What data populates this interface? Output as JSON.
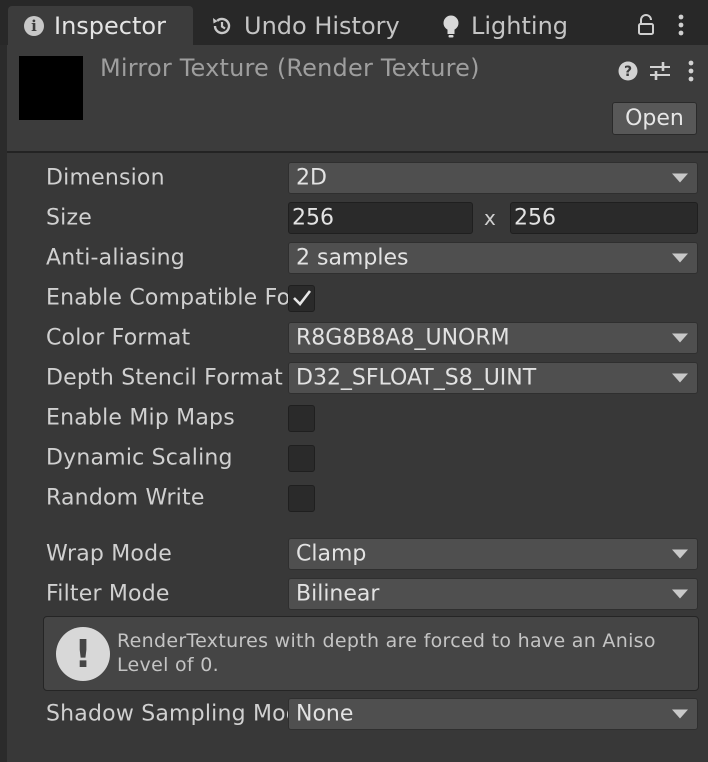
{
  "tabs": [
    {
      "label": "Inspector",
      "icon": "info-icon"
    },
    {
      "label": "Undo History",
      "icon": "history-icon"
    },
    {
      "label": "Lighting",
      "icon": "lightbulb-icon"
    }
  ],
  "tabbar_icons": [
    "lock-icon",
    "more-vertical-icon"
  ],
  "header": {
    "title": "Mirror Texture (Render Texture)",
    "open_label": "Open",
    "icons": [
      "help-icon",
      "preset-sliders-icon",
      "more-vertical-icon"
    ]
  },
  "properties": {
    "dimension": {
      "label": "Dimension",
      "value": "2D"
    },
    "size": {
      "label": "Size",
      "width": "256",
      "separator": "x",
      "height": "256"
    },
    "anti_aliasing": {
      "label": "Anti-aliasing",
      "value": "2 samples"
    },
    "enable_compatible_format": {
      "label": "Enable Compatible Format",
      "checked": true
    },
    "color_format": {
      "label": "Color Format",
      "value": "R8G8B8A8_UNORM"
    },
    "depth_stencil_format": {
      "label": "Depth Stencil Format",
      "value": "D32_SFLOAT_S8_UINT"
    },
    "enable_mip_maps": {
      "label": "Enable Mip Maps",
      "checked": false
    },
    "dynamic_scaling": {
      "label": "Dynamic Scaling",
      "checked": false
    },
    "random_write": {
      "label": "Random Write",
      "checked": false
    },
    "wrap_mode": {
      "label": "Wrap Mode",
      "value": "Clamp"
    },
    "filter_mode": {
      "label": "Filter Mode",
      "value": "Bilinear"
    },
    "shadow_sampling_mode": {
      "label": "Shadow Sampling Mode",
      "value": "None"
    }
  },
  "help_box": {
    "icon": "warning-exclamation-icon",
    "text": "RenderTextures with depth are forced to have an Aniso Level of 0."
  },
  "colors": {
    "panel_bg": "#383838",
    "tabbar_bg": "#282828",
    "active_tab_bg": "#3c3c3c",
    "field_bg": "#2a2a2a",
    "dropdown_bg": "#4f4f4f",
    "text": "#d0d0d0"
  }
}
